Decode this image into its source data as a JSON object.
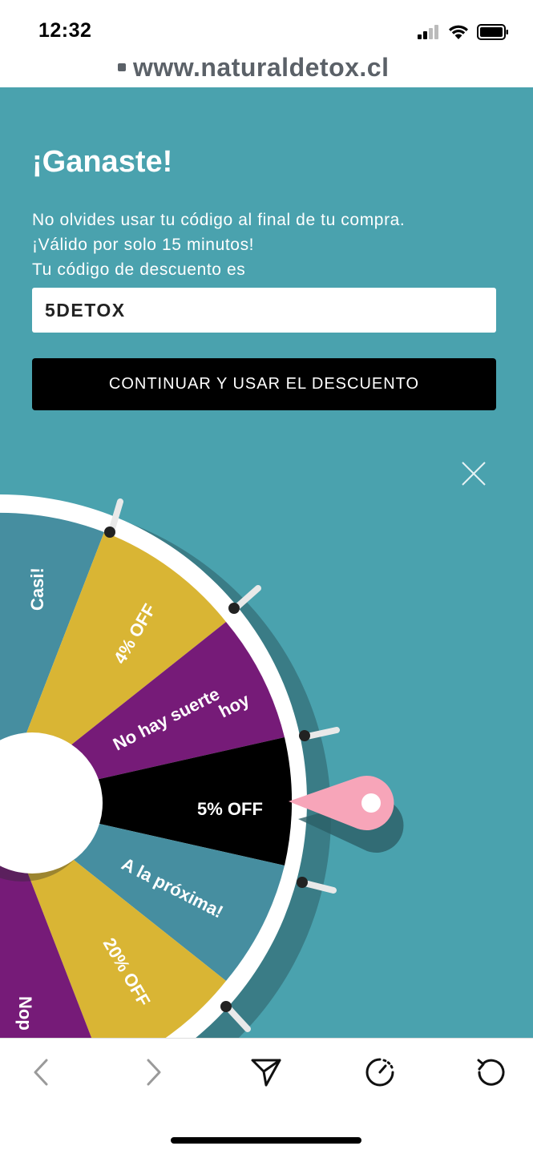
{
  "status_bar": {
    "time": "12:32",
    "icons": [
      "signal-icon",
      "wifi-icon",
      "battery-icon"
    ]
  },
  "browser": {
    "url": "www.naturaldetox.cl"
  },
  "popup": {
    "title": "¡Ganaste!",
    "message_lines": [
      "No olvides usar tu código al final de tu compra.",
      "¡Válido por solo 15 minutos!",
      "Tu código de descuento es"
    ],
    "code_value": "5DETOX",
    "continue_label": "CONTINUAR Y USAR EL DESCUENTO",
    "close_icon": "close-icon"
  },
  "wheel": {
    "segments": [
      {
        "label": "Casi!",
        "color": "#468ea0"
      },
      {
        "label": "4% OFF",
        "color": "#d9b534"
      },
      {
        "label": "No hay suerte hoy",
        "color": "#761b78"
      },
      {
        "label": "5% OFF",
        "color": "#000000"
      },
      {
        "label": "A la próxima!",
        "color": "#468ea0"
      },
      {
        "label": "20% OFF",
        "color": "#d9b534"
      },
      {
        "label": "Nop",
        "color": "#761b78"
      }
    ],
    "selected": "5% OFF",
    "pointer_color": "#f7a5b9"
  },
  "colors": {
    "popup_bg": "#4aa2ae",
    "button_bg": "#000000"
  },
  "toolbar": {
    "icons": [
      "back-icon",
      "forward-icon",
      "share-icon",
      "timer-icon",
      "reload-icon"
    ]
  }
}
